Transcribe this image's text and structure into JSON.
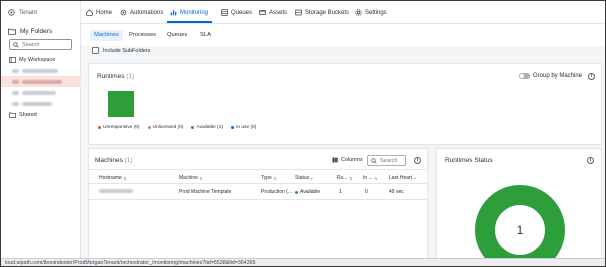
{
  "sidebar": {
    "tenant_label": "Tenant",
    "folders_title": "My Folders",
    "search_placeholder": "Search",
    "tree": [
      {
        "label": "My Workspace",
        "blurred": false
      },
      {
        "label": "",
        "blurred": true
      },
      {
        "label": "",
        "blurred": true,
        "active": true
      },
      {
        "label": "",
        "blurred": true
      },
      {
        "label": "",
        "blurred": true
      },
      {
        "label": "Shared",
        "blurred": false
      }
    ]
  },
  "nav": {
    "items": [
      {
        "label": "Home",
        "icon": "home-icon"
      },
      {
        "label": "Automations",
        "icon": "automations-icon"
      },
      {
        "label": "Monitoring",
        "icon": "monitoring-icon",
        "active": true
      },
      {
        "label": "Queues",
        "icon": "queues-icon"
      },
      {
        "label": "Assets",
        "icon": "assets-icon"
      },
      {
        "label": "Storage Buckets",
        "icon": "storage-icon"
      },
      {
        "label": "Settings",
        "icon": "settings-icon"
      }
    ]
  },
  "subtabs": {
    "items": [
      {
        "label": "Machines",
        "active": true
      },
      {
        "label": "Processes"
      },
      {
        "label": "Queues"
      },
      {
        "label": "SLA"
      }
    ],
    "include_subfolders": "Include SubFolders"
  },
  "runtimes": {
    "title": "Runtimes",
    "count": "(1)",
    "group_toggle": "Group by Machine",
    "tile_color": "#2e9e3a",
    "legend": [
      {
        "label": "Unresponsive (0)",
        "color": "#e5483b"
      },
      {
        "label": "Unlicensed (0)",
        "color": "#f07b3f"
      },
      {
        "label": "Available (1)",
        "color": "#2e9e3a"
      },
      {
        "label": "In use (0)",
        "color": "#0067df"
      }
    ]
  },
  "machines": {
    "title": "Machines",
    "count": "(1)",
    "columns_label": "Columns",
    "search_placeholder": "Search",
    "headers": {
      "hostname": "Hostname",
      "machine": "Machine",
      "type": "Type",
      "status": "Status",
      "ru": "Ru...",
      "in": "In ...",
      "heartbeat": "Last Heart..."
    },
    "rows": [
      {
        "hostname": "",
        "machine": "Prod Machine Template",
        "type": "Production (...",
        "status": "Available",
        "ru": "1",
        "in": "0",
        "heartbeat": "49 sec"
      }
    ]
  },
  "runtime_status": {
    "title": "Runtimes Status",
    "center_value": "1",
    "ring_color": "#2e9e3a"
  },
  "status_bar": {
    "url": "loud.uipath.com/lbooindexter/ProdMorganTenant/orchestrator_/monitoring/machines?tid=5538&fid=364365"
  },
  "colors": {
    "accent": "#0067df",
    "available": "#2e9e3a",
    "active_folder_bg": "#fbe2e0"
  }
}
